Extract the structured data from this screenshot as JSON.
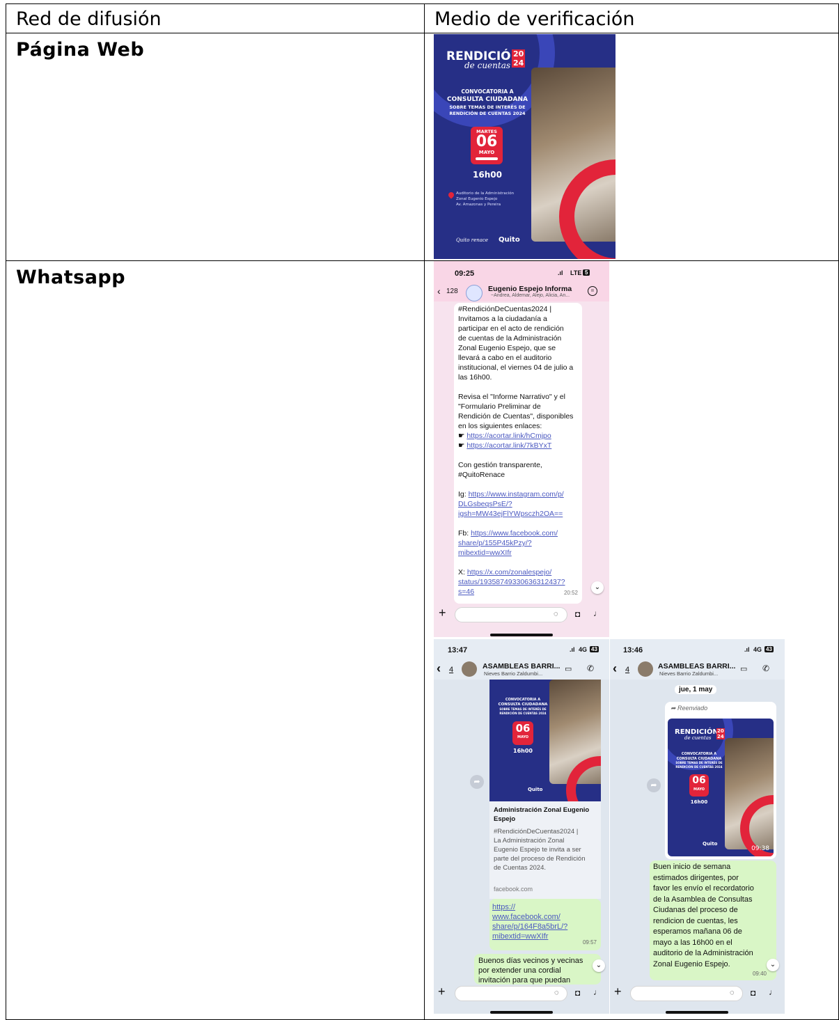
{
  "table": {
    "header_col1": "Red de difusión",
    "header_col2": "Medio de verificación",
    "row1_label": "Página Web",
    "row2_label": "Whatsapp"
  },
  "poster": {
    "title_line1": "RENDICIÓN",
    "title_line2": "de cuentas",
    "year_top": "20",
    "year_bottom": "24",
    "convoca1": "CONVOCATORIA A",
    "convoca2": "CONSULTA CIUDADANA",
    "convoca3": "SOBRE TEMAS DE INTERÉS DE",
    "convoca4": "RENDICIÓN DE CUENTAS 2024",
    "weekday": "MARTES",
    "day": "06",
    "month": "MAYO",
    "time": "16h00",
    "place1": "Auditorio de la Administración",
    "place2": "Zonal Eugenio Espejo",
    "place3": "Av. Amazonas y Pereira",
    "footer_slogan": "Quito renace",
    "footer_brand": "Quito",
    "colors": {
      "bg": "#262f86",
      "accent": "#e2243a",
      "circle": "#3a46b8"
    }
  },
  "phone1": {
    "time": "09:25",
    "signal": "LTE",
    "battery": "5",
    "back_count": "128",
    "chat_name": "Eugenio Espejo Informa",
    "chat_members": "~Andrea, Aldemar, Alejo, Alicia, An...",
    "message_lines": [
      "#RendiciónDeCuentas2024 |",
      "Invitamos a la ciudadanía a",
      "participar en el acto de rendición",
      "de cuentas de la Administración",
      "Zonal Eugenio Espejo, que se",
      "llevará a cabo en el auditorio",
      "institucional, el viernes 04 de julio a",
      "las 16h00.",
      "",
      "Revisa el \"Informe Narrativo\" y el",
      "\"Formulario Preliminar de",
      "Rendición de Cuentas\", disponibles",
      "en los siguientes enlaces:"
    ],
    "link1": "https://acortar.link/hCmjpo",
    "link2": "https://acortar.link/7kBYxT",
    "closing1": "Con gestión transparente,",
    "closing2": "#QuitoRenace",
    "ig_label": "Ig: ",
    "ig_link1": "https://www.instagram.com/p/",
    "ig_link2": "DLGsbeqsPsE/?",
    "ig_link3": "igsh=MW43ejFlYWpsczh2OA==",
    "fb_label": "Fb: ",
    "fb_link1": "https://www.facebook.com/",
    "fb_link2": "share/p/155P45kPzy/?",
    "fb_link3": "mibextid=wwXIfr",
    "x_label": "X: ",
    "x_link1": "https://x.com/zonalespejo/",
    "x_link2": "status/19358749330636312437?",
    "x_link3": "s=46",
    "msg_time": "20:52"
  },
  "phone2": {
    "time": "13:47",
    "signal": "4G",
    "battery": "43",
    "back_count": "4",
    "chat_name": "ASAMBLEAS BARRI...",
    "chat_members": "Nieves Barrio Zaldumbi...",
    "preview_title": "Administración Zonal Eugenio Espejo",
    "preview_text": [
      "#RendiciónDeCuentas2024 |",
      "La Administración Zonal",
      "Eugenio Espejo te invita a ser",
      "parte del proceso de Rendición",
      "de Cuentas 2024."
    ],
    "preview_domain": "facebook.com",
    "link_lines": [
      "https://",
      "www.facebook.com/",
      "share/p/164F8a5brL/?",
      "mibextid=wwXIfr"
    ],
    "link_time": "09:57",
    "next_msg": [
      "Buenos días vecinos y vecinas",
      "por extender una cordial",
      "invitación para que puedan"
    ]
  },
  "phone3": {
    "time": "13:46",
    "signal": "4G",
    "battery": "43",
    "back_count": "4",
    "chat_name": "ASAMBLEAS BARRI...",
    "chat_members": "Nieves Barrio Zaldumbi...",
    "date_chip": "jue, 1 may",
    "forwarded": "Reenviado",
    "image_time": "09:38",
    "message_lines": [
      "Buen inicio de semana",
      "estimados dirigentes,  por",
      "favor les envío el recordatorio",
      "de la Asamblea de Consultas",
      "Ciudanas del proceso de",
      "rendicion de cuentas, les",
      "esperamos mañana 06 de",
      "mayo a las 16h00 en el",
      "auditorio de la Administración",
      "Zonal Eugenio Espejo."
    ],
    "msg_time": "09:40"
  }
}
